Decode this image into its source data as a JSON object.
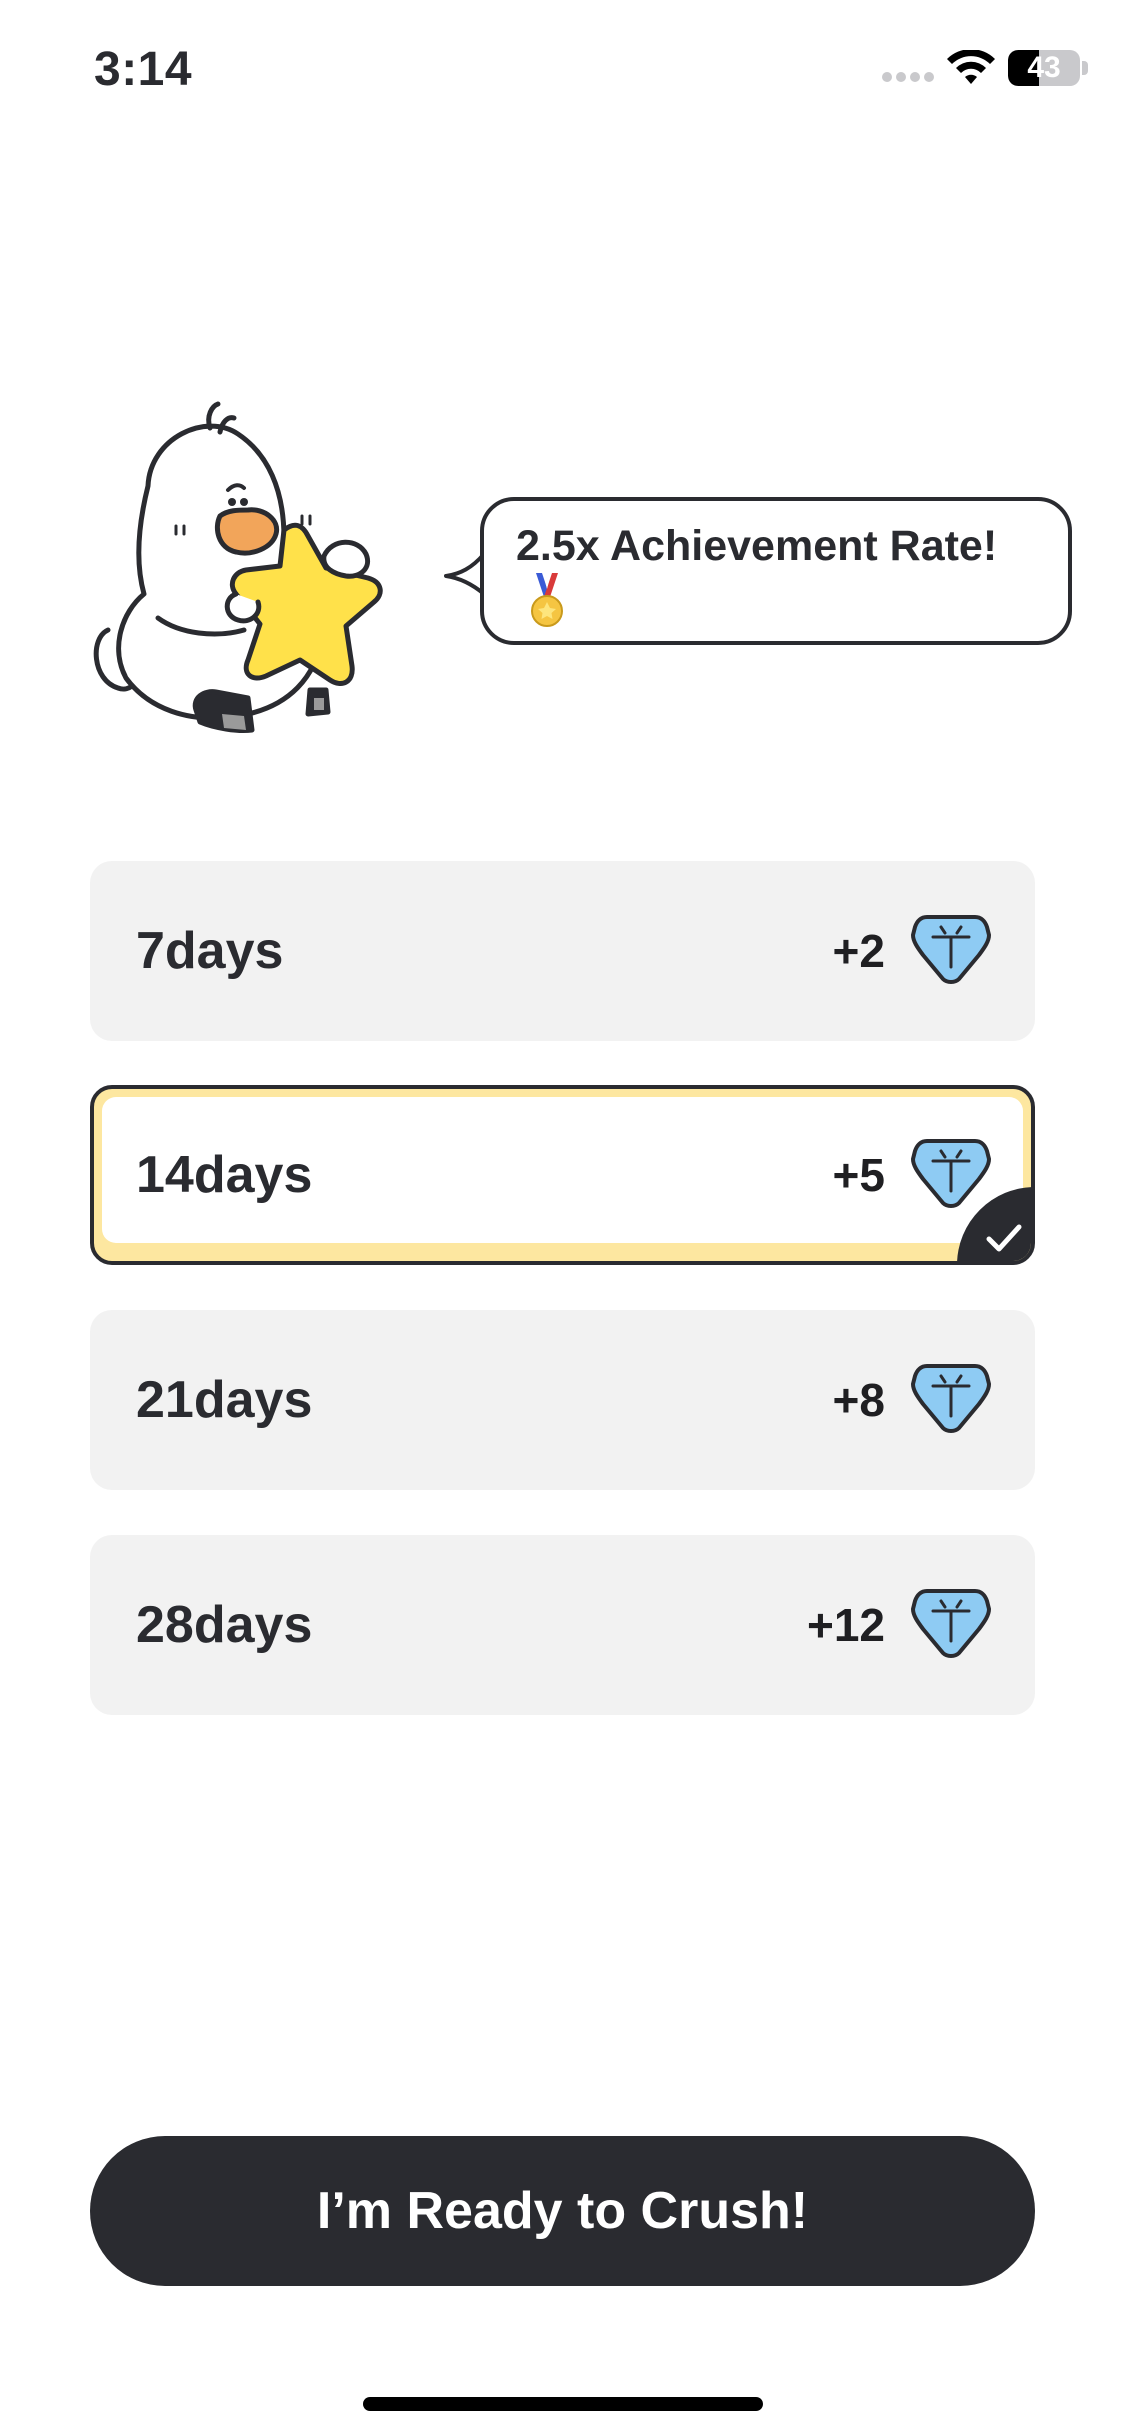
{
  "status_bar": {
    "time": "3:14",
    "battery_level": 43,
    "battery_text": "43"
  },
  "mascot": {
    "icon": "duck-holding-star-icon"
  },
  "bubble": {
    "text": "2.5x Achievement Rate!",
    "icon": "medal-icon"
  },
  "options": [
    {
      "label": "7days",
      "value": "+2",
      "icon": "gem-icon",
      "selected": false
    },
    {
      "label": "14days",
      "value": "+5",
      "icon": "gem-icon",
      "selected": true
    },
    {
      "label": "21days",
      "value": "+8",
      "icon": "gem-icon",
      "selected": false
    },
    {
      "label": "28days",
      "value": "+12",
      "icon": "gem-icon",
      "selected": false
    }
  ],
  "cta": {
    "label": "I’m Ready to Crush!"
  },
  "colors": {
    "primary_dark": "#2a2b30",
    "option_bg": "#f2f2f2",
    "selected_accent": "#fde7a0",
    "gem": "#8ecbf3",
    "star": "#ffe14a"
  }
}
